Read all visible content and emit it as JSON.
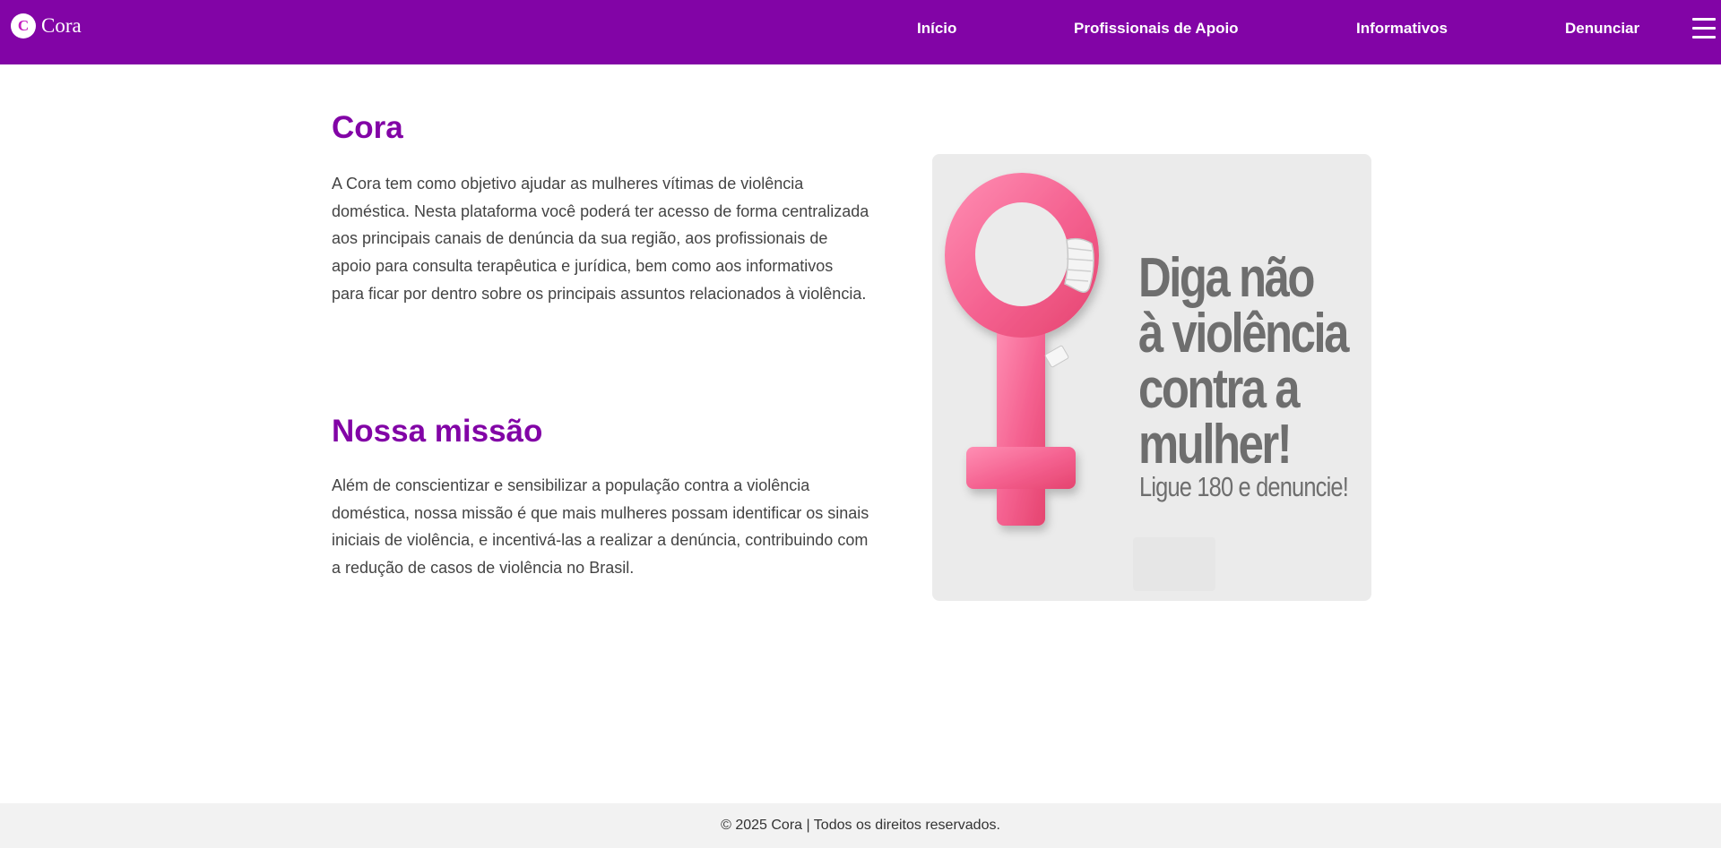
{
  "brand": {
    "logo_letter": "C",
    "name": "Cora"
  },
  "nav": {
    "items": [
      {
        "label": "Início"
      },
      {
        "label": "Profissionais de Apoio"
      },
      {
        "label": "Informativos"
      },
      {
        "label": "Denunciar"
      }
    ],
    "menu_icon": "hamburger-menu-icon"
  },
  "about": {
    "title": "Cora",
    "text": "A Cora tem como objetivo ajudar as mulheres vítimas de violência doméstica. Nesta plataforma você poderá ter acesso de forma centralizada aos principais canais de denúncia da sua região, aos profissionais de apoio para consulta terapêutica e jurídica, bem como aos informativos para ficar por dentro sobre os principais assuntos relacionados à violência."
  },
  "mission": {
    "title": "Nossa missão",
    "text": "Além de conscientizar e sensibilizar a população contra a violência doméstica, nossa missão é que mais mulheres possam identificar os sinais iniciais de violência, e incentivá-las a realizar a denúncia, contribuindo com a redução de casos de violência no Brasil."
  },
  "poster": {
    "headline_lines": [
      "Diga não",
      "à violência",
      "contra a",
      "mulher!"
    ],
    "subline": "Ligue 180 e denuncie!",
    "icon": "female-symbol-icon"
  },
  "footer": {
    "text": "© 2025 Cora | Todos os direitos reservados."
  },
  "colors": {
    "primary": "#8204a6",
    "poster_pink": "#f4608f",
    "text": "#444444",
    "footer_bg": "#f2f2f2"
  }
}
